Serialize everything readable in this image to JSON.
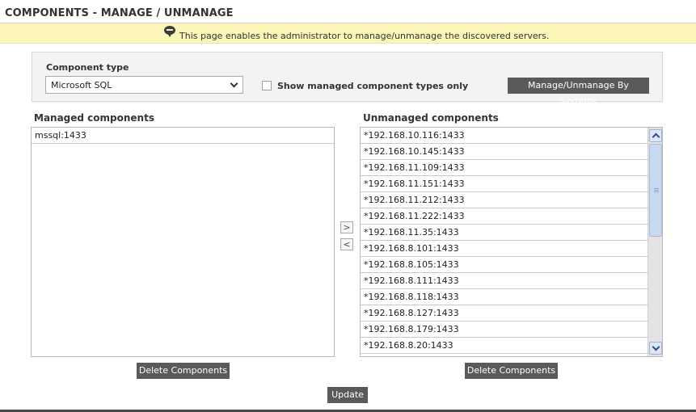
{
  "page": {
    "title": "COMPONENTS - MANAGE / UNMANAGE"
  },
  "info": {
    "icon": "speech-bubble-icon",
    "text": "This page enables the administrator to manage/unmanage the discovered servers."
  },
  "filter": {
    "component_type_label": "Component type",
    "component_type_value": "Microsoft SQL",
    "show_managed_label": "Show managed component types only",
    "show_managed_checked": false,
    "manage_by_systems_label": "Manage/Unmanage By Systems"
  },
  "managed": {
    "title": "Managed components",
    "items": [
      "mssql:1433"
    ],
    "delete_label": "Delete Components"
  },
  "unmanaged": {
    "title": "Unmanaged components",
    "items": [
      "*192.168.10.116:1433",
      "*192.168.10.145:1433",
      "*192.168.11.109:1433",
      "*192.168.11.151:1433",
      "*192.168.11.212:1433",
      "*192.168.11.222:1433",
      "*192.168.11.35:1433",
      "*192.168.8.101:1433",
      "*192.168.8.105:1433",
      "*192.168.8.111:1433",
      "*192.168.8.118:1433",
      "*192.168.8.127:1433",
      "*192.168.8.179:1433",
      "*192.168.8.20:1433"
    ],
    "delete_label": "Delete Components"
  },
  "move": {
    "right_label": ">",
    "left_label": "<"
  },
  "update_label": "Update"
}
